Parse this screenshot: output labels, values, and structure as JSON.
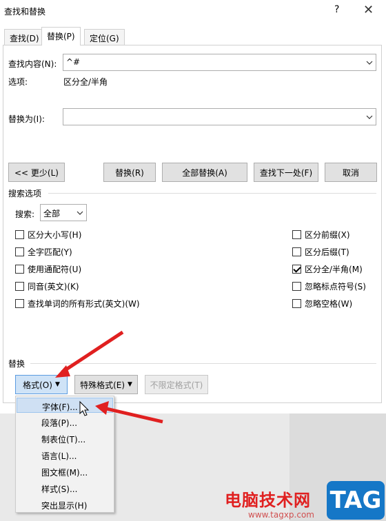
{
  "window": {
    "title": "查找和替换",
    "help": "?",
    "close": "✕"
  },
  "tabs": [
    {
      "label": "查找(D)"
    },
    {
      "label": "替换(P)",
      "active": true
    },
    {
      "label": "定位(G)"
    }
  ],
  "find": {
    "label": "查找内容(N):",
    "value": "^#",
    "options_label": "选项:",
    "options_value": "区分全/半角"
  },
  "replace": {
    "label": "替换为(I):",
    "value": ""
  },
  "buttons": {
    "less": "<< 更少(L)",
    "replace": "替换(R)",
    "replace_all": "全部替换(A)",
    "find_next": "查找下一处(F)",
    "cancel": "取消"
  },
  "search_options": {
    "heading": "搜索选项",
    "search_label": "搜索:",
    "search_value": "全部",
    "left": [
      {
        "label": "区分大小写(H)",
        "checked": false
      },
      {
        "label": "全字匹配(Y)",
        "checked": false
      },
      {
        "label": "使用通配符(U)",
        "checked": false
      },
      {
        "label": "同音(英文)(K)",
        "checked": false
      },
      {
        "label": "查找单词的所有形式(英文)(W)",
        "checked": false
      }
    ],
    "right": [
      {
        "label": "区分前缀(X)",
        "checked": false
      },
      {
        "label": "区分后缀(T)",
        "checked": false
      },
      {
        "label": "区分全/半角(M)",
        "checked": true
      },
      {
        "label": "忽略标点符号(S)",
        "checked": false
      },
      {
        "label": "忽略空格(W)",
        "checked": false
      }
    ]
  },
  "replace_section": {
    "heading": "替换",
    "format_btn": "格式(O)",
    "special_btn": "特殊格式(E)",
    "no_format_btn": "不限定格式(T)"
  },
  "format_menu": [
    "字体(F)...",
    "段落(P)...",
    "制表位(T)...",
    "语言(L)...",
    "图文框(M)...",
    "样式(S)...",
    "突出显示(H)"
  ],
  "watermark": {
    "text": "电脑技术网",
    "url": "www.tagxp.com",
    "logo": "TAG"
  },
  "colors": {
    "arrow": "#e02020",
    "highlight": "#cfe0f3",
    "logo_bg": "#1577c7"
  }
}
